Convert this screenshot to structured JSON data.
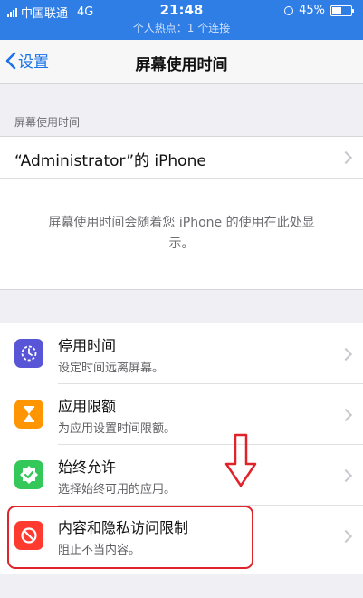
{
  "status_bar": {
    "carrier": "中国联通",
    "network": "4G",
    "time": "21:48",
    "hotspot": "个人热点：1 个连接",
    "battery_text": "45%",
    "battery_level": 0.45
  },
  "nav": {
    "back_label": "设置",
    "title": "屏幕使用时间"
  },
  "section_header": "屏幕使用时间",
  "device": {
    "label": "“Administrator”的 iPhone"
  },
  "description": "屏幕使用时间会随着您 iPhone 的使用在此处显示。",
  "rows": [
    {
      "title": "停用时间",
      "subtitle": "设定时间远离屏幕。",
      "icon": "downtime-icon",
      "color": "#5856d6"
    },
    {
      "title": "应用限额",
      "subtitle": "为应用设置时间限额。",
      "icon": "hourglass-icon",
      "color": "#ff9500"
    },
    {
      "title": "始终允许",
      "subtitle": "选择始终可用的应用。",
      "icon": "checkmark-badge-icon",
      "color": "#34c759"
    },
    {
      "title": "内容和隐私访问限制",
      "subtitle": "阻止不当内容。",
      "icon": "restriction-icon",
      "color": "#ff3b30"
    }
  ],
  "annotation_colors": {
    "arrow": "#e0222a",
    "highlight": "#e0222a"
  }
}
